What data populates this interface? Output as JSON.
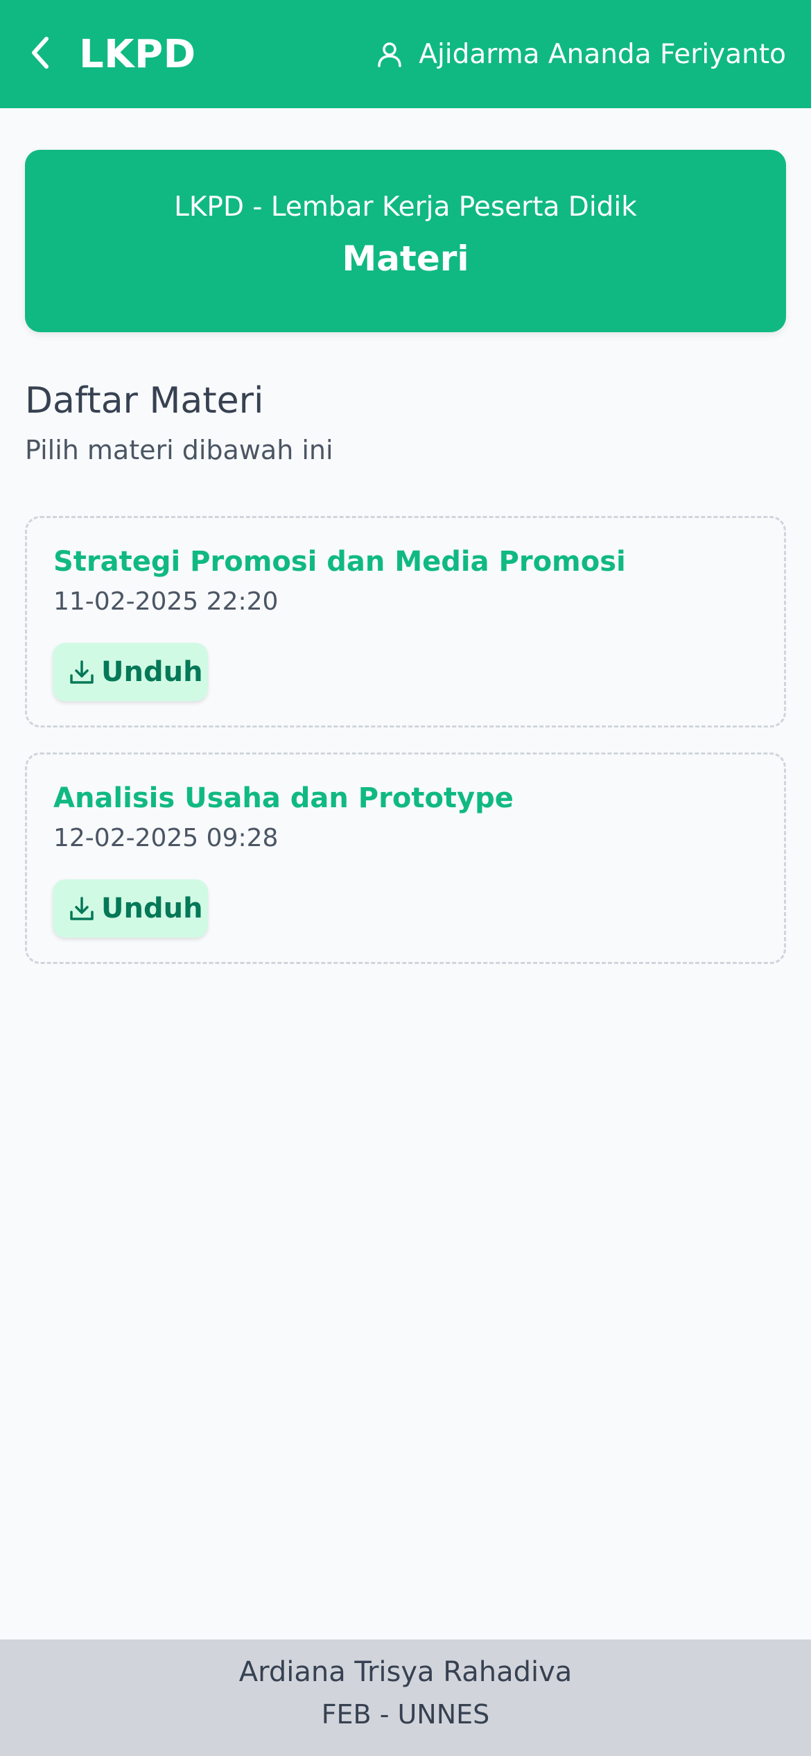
{
  "header": {
    "back_icon": "chevron-left-icon",
    "title": "LKPD",
    "user_icon": "user-icon",
    "user_name": "Ajidarma Ananda Feriyanto"
  },
  "hero": {
    "subtitle": "LKPD - Lembar Kerja Peserta Didik",
    "title": "Materi"
  },
  "section": {
    "title": "Daftar Materi",
    "subtitle": "Pilih materi dibawah ini"
  },
  "materials": [
    {
      "title": "Strategi Promosi dan Media Promosi",
      "date": "11-02-2025 22:20",
      "download_label": "Unduh",
      "download_icon": "download-icon"
    },
    {
      "title": "Analisis Usaha dan Prototype",
      "date": "12-02-2025 09:28",
      "download_label": "Unduh",
      "download_icon": "download-icon"
    }
  ],
  "footer": {
    "name": "Ardiana Trisya Rahadiva",
    "org": "FEB - UNNES"
  },
  "colors": {
    "primary": "#10b981",
    "primary_light": "#d1fae5",
    "primary_dark": "#047857",
    "text": "#374151",
    "background": "#f8fafc",
    "footer_bg": "#d1d5db"
  }
}
